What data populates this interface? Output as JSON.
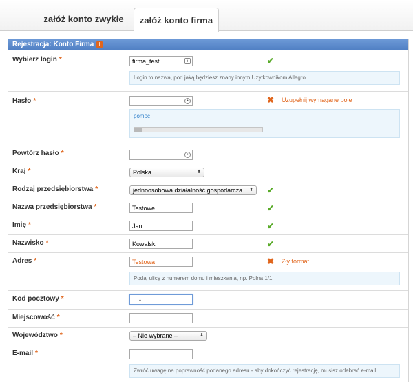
{
  "tabs": [
    {
      "label": "załóż konto zwykłe"
    },
    {
      "label": "załóż konto firma"
    }
  ],
  "header": {
    "title": "Rejestracja: Konto Firma"
  },
  "fields": {
    "login": {
      "label": "Wybierz login",
      "value": "firma_test",
      "hint": "Login to nazwa, pod jaką będziesz znany innym Użytkownikom Allegro."
    },
    "password": {
      "label": "Hasło",
      "value": "",
      "error": "Uzupełnij wymagane pole",
      "help_link": "pomoc",
      "strength": 0.06
    },
    "password_repeat": {
      "label": "Powtórz hasło",
      "value": ""
    },
    "country": {
      "label": "Kraj",
      "value": "Polska"
    },
    "business_type": {
      "label": "Rodzaj przedsiębiorstwa",
      "value": "jednoosobowa działalność gospodarcza"
    },
    "company_name": {
      "label": "Nazwa przedsiębiorstwa",
      "value": "Testowe"
    },
    "first_name": {
      "label": "Imię",
      "value": "Jan"
    },
    "last_name": {
      "label": "Nazwisko",
      "value": "Kowalski"
    },
    "address": {
      "label": "Adres",
      "value": "Testowa",
      "error": "Zły format",
      "hint": "Podaj ulicę z numerem domu i mieszkania, np. Polna 1/1."
    },
    "postal_code": {
      "label": "Kod pocztowy",
      "value": "__-___"
    },
    "city": {
      "label": "Miejscowość",
      "value": ""
    },
    "voivodeship": {
      "label": "Województwo",
      "value": "– Nie wybrane –"
    },
    "email": {
      "label": "E-mail",
      "value": "",
      "hint": "Zwróć uwagę na poprawność podanego adresu - aby dokończyć rejestrację, musisz odebrać e-mail."
    }
  },
  "required_mark": "*",
  "colors": {
    "header": "#5a88c9",
    "required": "#e0651c",
    "valid": "#5aab2a",
    "error": "#e0651c",
    "hint_bg": "#edf6fc"
  }
}
